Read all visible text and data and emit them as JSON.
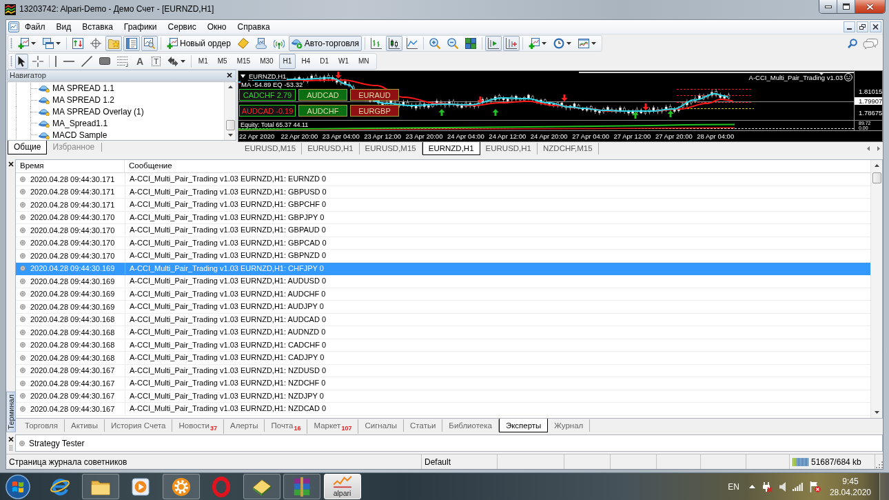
{
  "window": {
    "title": "13203742: Alpari-Demo - Демо Счет - [EURNZD,H1]"
  },
  "menu": [
    "Файл",
    "Вид",
    "Вставка",
    "Графики",
    "Сервис",
    "Окно",
    "Справка"
  ],
  "toolbar": {
    "groups": [
      [
        {
          "pressed": false,
          "dropdown": true
        },
        {
          "pressed": false,
          "dropdown": true
        }
      ],
      [
        {
          "pressed": false
        },
        {
          "pressed": false
        },
        {
          "pressed": true
        },
        {
          "pressed": true
        },
        {
          "pressed": true
        }
      ],
      [
        {
          "label": "Новый ордер",
          "pressed": false
        },
        {
          "pressed": false
        },
        {
          "pressed": false
        },
        {
          "pressed": false
        },
        {
          "label": "Авто-торговля",
          "pressed": true
        }
      ],
      [
        {
          "pressed": false
        },
        {
          "pressed": true
        },
        {
          "pressed": false
        }
      ],
      [
        {
          "pressed": false
        },
        {
          "pressed": false
        },
        {
          "pressed": false
        }
      ],
      [
        {
          "pressed": true
        },
        {
          "pressed": true
        }
      ],
      [
        {
          "pressed": false,
          "dropdown": true
        },
        {
          "pressed": false,
          "dropdown": true
        },
        {
          "pressed": false,
          "dropdown": true
        }
      ]
    ]
  },
  "drawing_toolbar": {
    "groups": [
      [
        {
          "pressed": true
        },
        {
          "pressed": false
        }
      ],
      [
        {
          "pressed": false
        },
        {
          "pressed": false
        },
        {
          "pressed": false
        },
        {
          "pressed": false
        },
        {
          "pressed": false
        },
        {
          "label": "A",
          "pressed": false
        },
        {
          "label": "T",
          "pressed": false
        },
        {
          "pressed": false,
          "dropdown": true
        }
      ]
    ]
  },
  "periods": [
    {
      "label": "M1",
      "selected": false
    },
    {
      "label": "M5",
      "selected": false
    },
    {
      "label": "M15",
      "selected": false
    },
    {
      "label": "M30",
      "selected": false
    },
    {
      "label": "H1",
      "selected": true
    },
    {
      "label": "H4",
      "selected": false
    },
    {
      "label": "D1",
      "selected": false
    },
    {
      "label": "W1",
      "selected": false
    },
    {
      "label": "MN",
      "selected": false
    }
  ],
  "navigator": {
    "title": "Навигатор",
    "items": [
      "MA SPREAD 1.1",
      "MA SPREAD 1.2",
      "MA SPREAD Overlay (1)",
      "MA_Spread1.1",
      "MACD Sample"
    ],
    "tabs": [
      {
        "label": "Общие",
        "selected": true
      },
      {
        "label": "Избранное",
        "selected": false
      }
    ]
  },
  "chart": {
    "symbol": "EURNZD,H1",
    "indicator": "MA -54.89 EQ -53.32",
    "expert": "A-CCI_Multi_Pair_Trading v1.03",
    "buttons": [
      {
        "label": "CADCHF 2.79",
        "kind": "outline",
        "color": "#22dd22"
      },
      {
        "label": "AUDCAD",
        "kind": "filled",
        "color": "#0b6e12"
      },
      {
        "label": "EURAUD",
        "kind": "filled",
        "color": "#8e1010"
      },
      {
        "label": "AUDCAD -0.19",
        "kind": "outline",
        "color": "#ff2424"
      },
      {
        "label": "AUDCHF",
        "kind": "filled",
        "color": "#0b6e12"
      },
      {
        "label": "EURGBP",
        "kind": "filled",
        "color": "#8e1010"
      }
    ],
    "price_labels": [
      {
        "text": "1.81015",
        "highlighted": false
      },
      {
        "text": "1.79907",
        "highlighted": true
      },
      {
        "text": "1.78675",
        "highlighted": false
      }
    ],
    "equity": "Equity: Total 65.37 44.11",
    "equity_scale": [
      "89.72",
      "0.00"
    ],
    "time_labels": [
      "22 Apr 2020",
      "22 Apr 20:00",
      "23 Apr 04:00",
      "23 Apr 12:00",
      "23 Apr 20:00",
      "24 Apr 04:00",
      "24 Apr 12:00",
      "24 Apr 20:00",
      "27 Apr 04:00",
      "27 Apr 12:00",
      "27 Apr 20:00",
      "28 Apr 04:00"
    ]
  },
  "chart_tabs": [
    {
      "label": "EURUSD,M15",
      "selected": false
    },
    {
      "label": "EURUSD,H1",
      "selected": false
    },
    {
      "label": "EURUSD,M15",
      "selected": false
    },
    {
      "label": "EURNZD,H1",
      "selected": true
    },
    {
      "label": "EURUSD,H1",
      "selected": false
    },
    {
      "label": "NZDCHF,M15",
      "selected": false
    }
  ],
  "terminal": {
    "side_label": "Терминал",
    "columns": [
      "Время",
      "Сообщение"
    ],
    "rows": [
      {
        "time": "2020.04.28 09:44:30.171",
        "message": "A-CCI_Multi_Pair_Trading v1.03 EURNZD,H1: EURNZD 0",
        "selected": false
      },
      {
        "time": "2020.04.28 09:44:30.171",
        "message": "A-CCI_Multi_Pair_Trading v1.03 EURNZD,H1: GBPUSD 0",
        "selected": false
      },
      {
        "time": "2020.04.28 09:44:30.171",
        "message": "A-CCI_Multi_Pair_Trading v1.03 EURNZD,H1: GBPCHF 0",
        "selected": false
      },
      {
        "time": "2020.04.28 09:44:30.170",
        "message": "A-CCI_Multi_Pair_Trading v1.03 EURNZD,H1: GBPJPY 0",
        "selected": false
      },
      {
        "time": "2020.04.28 09:44:30.170",
        "message": "A-CCI_Multi_Pair_Trading v1.03 EURNZD,H1: GBPAUD 0",
        "selected": false
      },
      {
        "time": "2020.04.28 09:44:30.170",
        "message": "A-CCI_Multi_Pair_Trading v1.03 EURNZD,H1: GBPCAD 0",
        "selected": false
      },
      {
        "time": "2020.04.28 09:44:30.170",
        "message": "A-CCI_Multi_Pair_Trading v1.03 EURNZD,H1: GBPNZD 0",
        "selected": false
      },
      {
        "time": "2020.04.28 09:44:30.169",
        "message": "A-CCI_Multi_Pair_Trading v1.03 EURNZD,H1: CHFJPY 0",
        "selected": true
      },
      {
        "time": "2020.04.28 09:44:30.169",
        "message": "A-CCI_Multi_Pair_Trading v1.03 EURNZD,H1: AUDUSD 0",
        "selected": false
      },
      {
        "time": "2020.04.28 09:44:30.169",
        "message": "A-CCI_Multi_Pair_Trading v1.03 EURNZD,H1: AUDCHF 0",
        "selected": false
      },
      {
        "time": "2020.04.28 09:44:30.169",
        "message": "A-CCI_Multi_Pair_Trading v1.03 EURNZD,H1: AUDJPY 0",
        "selected": false
      },
      {
        "time": "2020.04.28 09:44:30.168",
        "message": "A-CCI_Multi_Pair_Trading v1.03 EURNZD,H1: AUDCAD 0",
        "selected": false
      },
      {
        "time": "2020.04.28 09:44:30.168",
        "message": "A-CCI_Multi_Pair_Trading v1.03 EURNZD,H1: AUDNZD 0",
        "selected": false
      },
      {
        "time": "2020.04.28 09:44:30.168",
        "message": "A-CCI_Multi_Pair_Trading v1.03 EURNZD,H1: CADCHF 0",
        "selected": false
      },
      {
        "time": "2020.04.28 09:44:30.168",
        "message": "A-CCI_Multi_Pair_Trading v1.03 EURNZD,H1: CADJPY 0",
        "selected": false
      },
      {
        "time": "2020.04.28 09:44:30.167",
        "message": "A-CCI_Multi_Pair_Trading v1.03 EURNZD,H1: NZDUSD 0",
        "selected": false
      },
      {
        "time": "2020.04.28 09:44:30.167",
        "message": "A-CCI_Multi_Pair_Trading v1.03 EURNZD,H1: NZDCHF 0",
        "selected": false
      },
      {
        "time": "2020.04.28 09:44:30.167",
        "message": "A-CCI_Multi_Pair_Trading v1.03 EURNZD,H1: NZDJPY 0",
        "selected": false
      },
      {
        "time": "2020.04.28 09:44:30.167",
        "message": "A-CCI_Multi_Pair_Trading v1.03 EURNZD,H1: NZDCAD 0",
        "selected": false
      }
    ],
    "tabs": [
      {
        "label": "Торговля",
        "selected": false
      },
      {
        "label": "Активы",
        "selected": false
      },
      {
        "label": "История Счета",
        "selected": false
      },
      {
        "label": "Новости",
        "count": "37",
        "selected": false
      },
      {
        "label": "Алерты",
        "selected": false
      },
      {
        "label": "Почта",
        "count": "16",
        "selected": false
      },
      {
        "label": "Маркет",
        "count": "107",
        "selected": false
      },
      {
        "label": "Сигналы",
        "selected": false
      },
      {
        "label": "Статьи",
        "selected": false
      },
      {
        "label": "Библиотека",
        "selected": false
      },
      {
        "label": "Эксперты",
        "selected": true
      },
      {
        "label": "Журнал",
        "selected": false
      }
    ]
  },
  "tester": {
    "items": [
      "Strategy Tester"
    ]
  },
  "status_bar": {
    "cells": [
      "Страница журнала советников",
      "Default"
    ],
    "memory": "51687/684 kb"
  },
  "taskbar": {
    "apps": [
      {
        "running": false,
        "selected": false
      },
      {
        "running": true,
        "selected": false
      },
      {
        "running": false,
        "selected": false
      },
      {
        "running": true,
        "selected": false
      },
      {
        "running": false,
        "selected": false
      },
      {
        "running": true,
        "selected": false
      },
      {
        "running": true,
        "selected": false
      },
      {
        "label": "alpari",
        "running": true,
        "selected": true
      }
    ],
    "language": "EN",
    "time": "9:45",
    "date": "28.04.2020"
  }
}
